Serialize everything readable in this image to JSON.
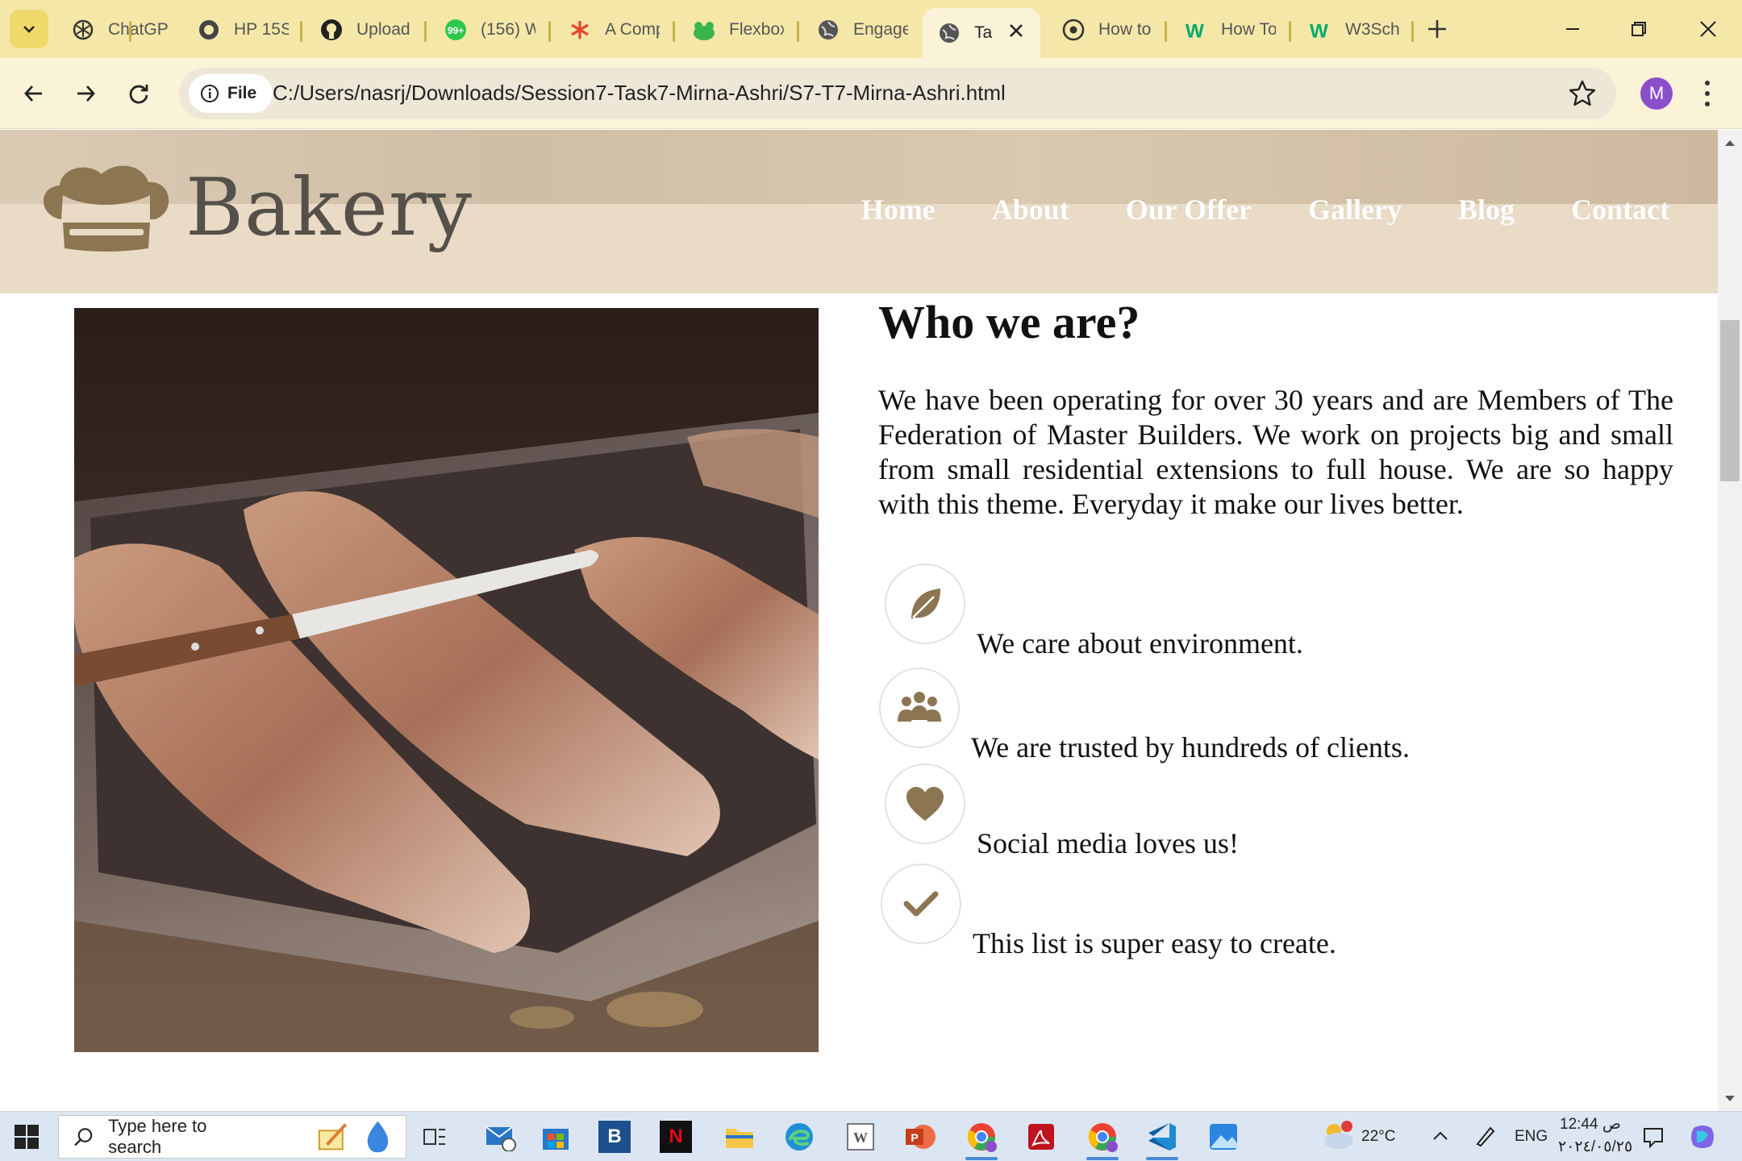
{
  "browser": {
    "tabs": [
      {
        "title": "ChatGP",
        "icon": "openai-icon"
      },
      {
        "title": "HP 15S",
        "icon": "circle-logo-icon"
      },
      {
        "title": "Upload",
        "icon": "github-icon"
      },
      {
        "title": "(156) W",
        "icon": "whatsapp-icon"
      },
      {
        "title": "A Comp",
        "icon": "asterisk-icon"
      },
      {
        "title": "Flexbox",
        "icon": "frog-icon"
      },
      {
        "title": "Engage",
        "icon": "globe-icon"
      },
      {
        "title": "Ta",
        "icon": "globe-icon",
        "active": true
      },
      {
        "title": "How to",
        "icon": "chrome-web-icon"
      },
      {
        "title": "How To",
        "icon": "w3-icon"
      },
      {
        "title": "W3Sch",
        "icon": "w3-icon"
      }
    ],
    "site_chip": "File",
    "url": "C:/Users/nasrj/Downloads/Session7-Task7-Mirna-Ashri/S7-T7-Mirna-Ashri.html",
    "profile_initial": "M",
    "accent": "#f5e7a8"
  },
  "site": {
    "logo": "Bakery",
    "nav": [
      "Home",
      "About",
      "Our Offer",
      "Gallery",
      "Blog",
      "Contact"
    ],
    "about": {
      "title": "Who we are?",
      "text": "We have been operating for over 30 years and are Members of The Federation of Master Builders. We work on projects big and small from small residential extensions to full house. We are so happy with this theme. Everyday it make our lives better.",
      "features": [
        {
          "icon": "leaf-icon",
          "text": "We care about environment."
        },
        {
          "icon": "users-icon",
          "text": "We are trusted by hundreds of clients."
        },
        {
          "icon": "heart-icon",
          "text": "Social media loves us!"
        },
        {
          "icon": "check-icon",
          "text": "This list is super easy to create."
        }
      ],
      "icon_color": "#8c7551"
    }
  },
  "taskbar": {
    "search_placeholder": "Type here to search",
    "temperature": "22°C",
    "language": "ENG",
    "time": "12:44 ص",
    "date": "٢٠٢٤/٠٥/٢٥"
  }
}
